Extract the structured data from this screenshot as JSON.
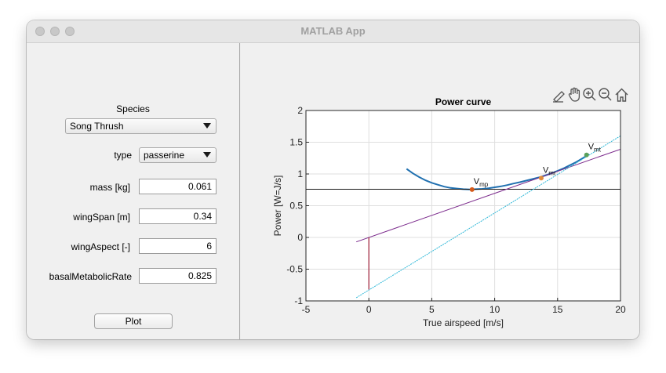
{
  "window": {
    "title": "MATLAB App"
  },
  "controls": {
    "species_label": "Species",
    "species_value": "Song Thrush",
    "type_label": "type",
    "type_value": "passerine",
    "fields": [
      {
        "label": "mass [kg]",
        "value": "0.061"
      },
      {
        "label": "wingSpan [m]",
        "value": "0.34"
      },
      {
        "label": "wingAspect [-]",
        "value": "6"
      },
      {
        "label": "basalMetabolicRate",
        "value": "0.825"
      }
    ],
    "plot_button": "Plot"
  },
  "toolbar": {
    "icons": [
      "annotate-icon",
      "pan-icon",
      "zoom-in-icon",
      "zoom-out-icon",
      "home-icon"
    ]
  },
  "chart_data": {
    "type": "line",
    "title": "Power curve",
    "xlabel": "True airspeed [m/s]",
    "ylabel": "Power [W=J/s]",
    "xlim": [
      -5,
      20
    ],
    "ylim": [
      -1,
      2
    ],
    "xticks": [
      -5,
      0,
      5,
      10,
      15,
      20
    ],
    "yticks": [
      -1,
      -0.5,
      0,
      0.5,
      1,
      1.5,
      2
    ],
    "grid": true,
    "colors": {
      "curve": "#2070b0",
      "hline": "#1a1a1a",
      "mr_line": "#7b2a8c",
      "mt_line": "#2fb8d8",
      "vline": "#a0203a",
      "vmp": "#d45a1a",
      "vmr": "#e08c3a",
      "vmt": "#5aa05a"
    },
    "series": [
      {
        "type": "curve",
        "x": [
          3,
          3.5,
          4,
          4.5,
          5,
          5.5,
          6,
          6.5,
          7,
          7.5,
          8,
          8.5,
          9,
          9.5,
          10,
          10.5,
          11,
          11.5,
          12,
          12.5,
          13,
          13.5,
          14,
          14.5,
          15,
          15.5,
          16,
          16.5,
          17,
          17.5
        ],
        "y": [
          1.08,
          1.01,
          0.95,
          0.9,
          0.86,
          0.83,
          0.8,
          0.78,
          0.77,
          0.76,
          0.755,
          0.76,
          0.765,
          0.775,
          0.79,
          0.805,
          0.825,
          0.85,
          0.87,
          0.895,
          0.92,
          0.945,
          0.975,
          1.01,
          1.05,
          1.09,
          1.14,
          1.19,
          1.25,
          1.31
        ]
      },
      {
        "type": "hline",
        "y": 0.76,
        "x": [
          -5,
          20
        ]
      },
      {
        "type": "tangent_mr",
        "x": [
          -1,
          20
        ],
        "y": [
          -0.07,
          1.39
        ]
      },
      {
        "type": "tangent_mt",
        "x": [
          -1,
          20
        ],
        "y": [
          -0.95,
          1.6
        ]
      },
      {
        "type": "vline",
        "x": 0,
        "y": [
          -0.82,
          0
        ]
      }
    ],
    "points": [
      {
        "label": "V",
        "sub": "mp",
        "x": 8.2,
        "y": 0.755
      },
      {
        "label": "V",
        "sub": "mr",
        "x": 13.7,
        "y": 0.935
      },
      {
        "label": "V",
        "sub": "mt",
        "x": 17.3,
        "y": 1.3
      }
    ]
  }
}
